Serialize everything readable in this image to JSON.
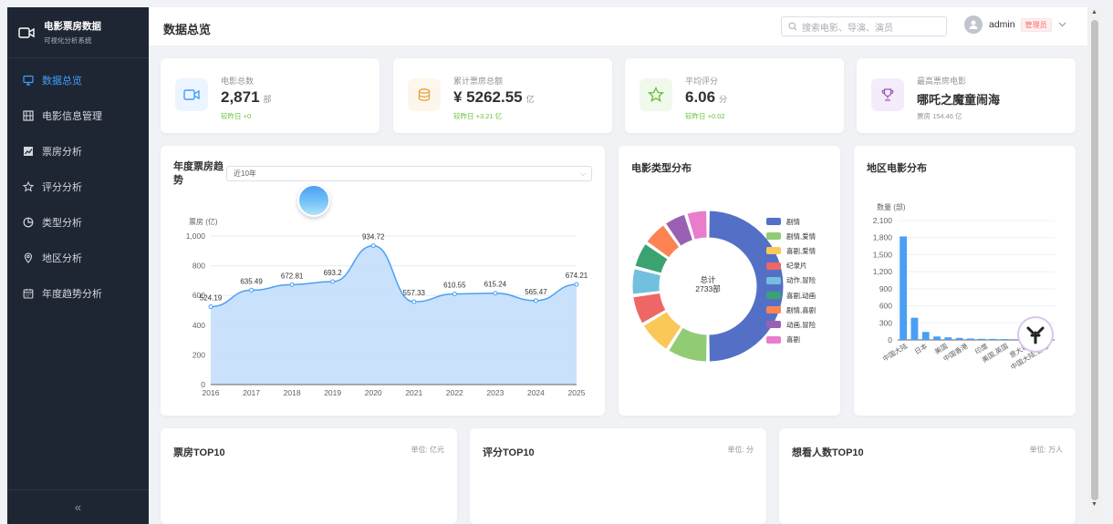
{
  "sidebar": {
    "title": "电影票房数据",
    "subtitle": "可视化分析系统",
    "items": [
      {
        "label": "数据总览",
        "icon": "monitor-icon",
        "active": true
      },
      {
        "label": "电影信息管理",
        "icon": "grid-icon",
        "active": false
      },
      {
        "label": "票房分析",
        "icon": "chart-icon",
        "active": false
      },
      {
        "label": "评分分析",
        "icon": "star-icon",
        "active": false
      },
      {
        "label": "类型分析",
        "icon": "pie-icon",
        "active": false
      },
      {
        "label": "地区分析",
        "icon": "location-icon",
        "active": false
      },
      {
        "label": "年度趋势分析",
        "icon": "calendar-icon",
        "active": false
      }
    ],
    "collapse_label": "«"
  },
  "header": {
    "title": "数据总览",
    "search_placeholder": "搜索电影、导演、演员",
    "username": "admin",
    "role": "管理员"
  },
  "stats": [
    {
      "label": "电影总数",
      "value": "2,871",
      "unit": "部",
      "sub": "较昨日 +0",
      "icon": "video-camera-icon",
      "color": "#409eff",
      "bg": "#ecf5ff"
    },
    {
      "label": "累计票房总额",
      "value": "¥ 5262.55",
      "unit": "亿",
      "sub": "较昨日 +3.21 亿",
      "icon": "coins-icon",
      "color": "#e6a23c",
      "bg": "#fdf6ec"
    },
    {
      "label": "平均评分",
      "value": "6.06",
      "unit": "分",
      "sub": "较昨日 +0.02",
      "icon": "star-outline-icon",
      "color": "#67c23a",
      "bg": "#f0f9eb"
    },
    {
      "label": "最高票房电影",
      "value": "哪吒之魔童闹海",
      "unit": "",
      "sub": "票房 154.46 亿",
      "icon": "trophy-icon",
      "color": "#9b59b6",
      "bg": "#f4ecfb"
    }
  ],
  "trend_card": {
    "title": "年度票房趋势",
    "select_value": "近10年"
  },
  "genre_card": {
    "title": "电影类型分布",
    "total_label": "总计",
    "total_value": "2733部"
  },
  "region_card": {
    "title": "地区电影分布"
  },
  "bottom_cards": [
    {
      "title": "票房TOP10",
      "unit": "单位: 亿元"
    },
    {
      "title": "评分TOP10",
      "unit": "单位: 分"
    },
    {
      "title": "想看人数TOP10",
      "unit": "单位: 万人"
    }
  ],
  "chart_data": [
    {
      "type": "area",
      "title": "年度票房趋势",
      "ylabel": "票房 (亿)",
      "x": [
        "2016",
        "2017",
        "2018",
        "2019",
        "2020",
        "2021",
        "2022",
        "2023",
        "2024",
        "2025"
      ],
      "values": [
        524.19,
        635.49,
        672.81,
        693.2,
        934.72,
        557.33,
        610.55,
        615.24,
        565.47,
        674.21
      ],
      "y_ticks": [
        "0",
        "200",
        "400",
        "600",
        "800",
        "1,000"
      ],
      "ylim": [
        0,
        1000
      ],
      "grid": true,
      "color": "#4a9ff5"
    },
    {
      "type": "pie",
      "title": "电影类型分布",
      "categories": [
        "剧情",
        "剧情,爱情",
        "喜剧,爱情",
        "纪录片",
        "动作,冒险",
        "喜剧,动画",
        "剧情,喜剧",
        "动画,冒险",
        "喜剧"
      ],
      "values": [
        1000,
        180,
        150,
        130,
        120,
        115,
        110,
        100,
        95
      ],
      "colors": [
        "#5470c6",
        "#91cc75",
        "#fac858",
        "#ee6666",
        "#73c0de",
        "#3ba272",
        "#fc8452",
        "#9a60b4",
        "#ea7ccc"
      ],
      "legend": "right"
    },
    {
      "type": "bar",
      "title": "地区电影分布",
      "ylabel": "数量 (部)",
      "categories": [
        "中国大陆",
        "日本",
        "美国",
        "中国香港",
        "印度",
        "美国,英国",
        "意大利",
        "中国大陆,香港"
      ],
      "values": [
        1820,
        390,
        140,
        60,
        45,
        35,
        25,
        20,
        18,
        15,
        12,
        10,
        8,
        6
      ],
      "y_ticks": [
        "0",
        "300",
        "600",
        "900",
        "1,200",
        "1,500",
        "1,800",
        "2,100"
      ],
      "ylim": [
        0,
        2100
      ],
      "grid": true,
      "color": "#4a9ff5"
    }
  ]
}
